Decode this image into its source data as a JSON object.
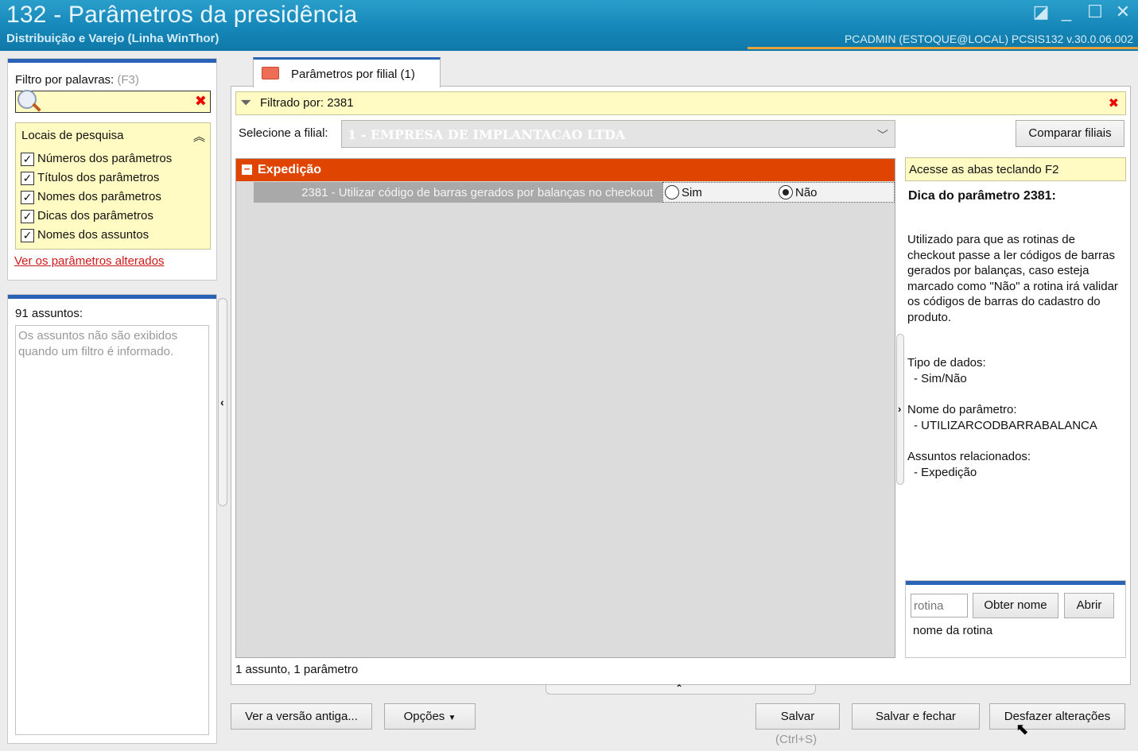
{
  "window": {
    "title": "132 - Parâmetros da presidência",
    "subtitle": "Distribuição e Varejo (Linha WinThor)",
    "user_info": "PCADMIN (ESTOQUE@LOCAL)   PCSIS132  v.30.0.06.002",
    "restore_icon": "◪",
    "minimize_icon": "_",
    "maximize_icon": "☐",
    "close_icon": "✕"
  },
  "filter": {
    "label": "Filtro por palavras:",
    "shortcut": "(F3)",
    "search_value": "",
    "clear_icon": "✖",
    "locations_title": "Locais de pesquisa",
    "collapse_icon": "︽",
    "options": [
      {
        "label": "Números dos parâmetros",
        "checked": true
      },
      {
        "label": "Títulos dos parâmetros",
        "checked": true
      },
      {
        "label": "Nomes dos parâmetros",
        "checked": true
      },
      {
        "label": "Dicas dos parâmetros",
        "checked": true
      },
      {
        "label": "Nomes dos assuntos",
        "checked": true
      }
    ],
    "changed_link": "Ver os parâmetros alterados"
  },
  "subjects": {
    "count_label": "91 assuntos:",
    "empty_message": "Os assuntos não são exibidos quando um filtro é informado."
  },
  "tab": {
    "label": "Parâmetros por filial  (1)"
  },
  "filter_bar": {
    "text": "Filtrado por: 2381",
    "close_icon": "✖"
  },
  "branch": {
    "label": "Selecione a filial:",
    "value": "1 - EMPRESA DE IMPLANTACAO LTDA",
    "compare_button": "Comparar filiais"
  },
  "grid": {
    "group_title": "Expedição",
    "group_toggle": "−",
    "row": {
      "text": "2381 - Utilizar código de barras gerados por balanças no checkout",
      "option_yes": "Sim",
      "option_no": "Não",
      "selected": "Não"
    },
    "summary": "1 assunto, 1 parâmetro"
  },
  "help": {
    "tabs_hint": "Acesse as abas teclando F2",
    "tip_title": "Dica do parâmetro 2381:",
    "tip_text": "Utilizado para que as rotinas de checkout passe a ler códigos de barras gerados por balanças, caso esteja marcado como \"Não\" a rotina irá validar os códigos de barras do cadastro do produto.",
    "data_type_label": "Tipo de dados:",
    "data_type_value": "- Sim/Não",
    "param_name_label": "Nome do parâmetro:",
    "param_name_value": "- UTILIZARCODBARRABALANCA",
    "related_label": "Assuntos relacionados:",
    "related_value": "- Expedição"
  },
  "routine": {
    "placeholder": "rotina",
    "get_name_button": "Obter nome",
    "open_button": "Abrir",
    "name_label": "nome da rotina"
  },
  "footer": {
    "old_version_button": "Ver a versão antiga...",
    "options_button": "Opções",
    "save_button": "Salvar",
    "save_shortcut": "(Ctrl+S)",
    "save_close_button": "Salvar e fechar",
    "undo_button": "Desfazer alterações"
  },
  "colors": {
    "titlebar": "#1587b8",
    "group_header": "#e04500",
    "panel_accent": "#2a62b5",
    "highlight_yellow": "#fffbc2",
    "link": "#d01919"
  }
}
